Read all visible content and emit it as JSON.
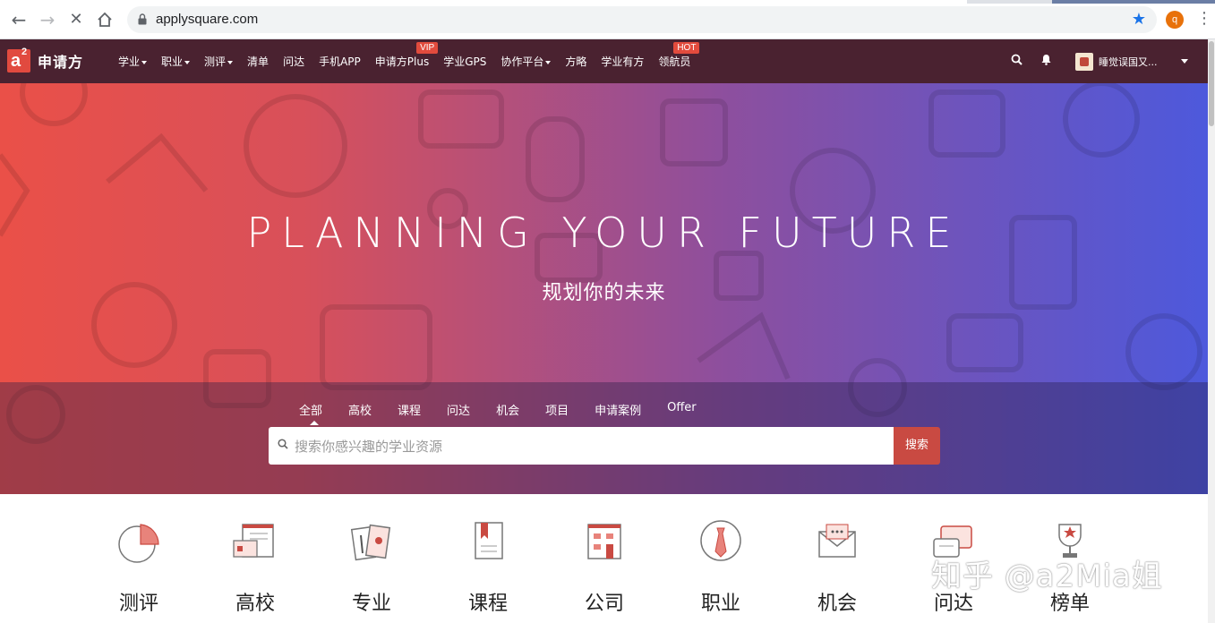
{
  "browser": {
    "url": "applysquare.com",
    "profile_initial": "q"
  },
  "site": {
    "logo_mark": "a",
    "logo_sup": "2",
    "logo_text": "申请方",
    "menu": [
      {
        "label": "学业",
        "dropdown": true,
        "badge": ""
      },
      {
        "label": "职业",
        "dropdown": true,
        "badge": ""
      },
      {
        "label": "测评",
        "dropdown": true,
        "badge": ""
      },
      {
        "label": "清单",
        "dropdown": false,
        "badge": ""
      },
      {
        "label": "问达",
        "dropdown": false,
        "badge": ""
      },
      {
        "label": "手机APP",
        "dropdown": false,
        "badge": ""
      },
      {
        "label": "申请方Plus",
        "dropdown": false,
        "badge": "VIP"
      },
      {
        "label": "学业GPS",
        "dropdown": false,
        "badge": ""
      },
      {
        "label": "协作平台",
        "dropdown": true,
        "badge": ""
      },
      {
        "label": "方略",
        "dropdown": false,
        "badge": ""
      },
      {
        "label": "学业有方",
        "dropdown": false,
        "badge": ""
      },
      {
        "label": "领航员",
        "dropdown": false,
        "badge": "HOT"
      }
    ],
    "user_name": "睡觉误国又..."
  },
  "hero": {
    "title": "PLANNING YOUR FUTURE",
    "subtitle": "规划你的未来",
    "tabs": [
      "全部",
      "高校",
      "课程",
      "问达",
      "机会",
      "项目",
      "申请案例",
      "Offer"
    ],
    "active_tab": 0,
    "search_placeholder": "搜索你感兴趣的学业资源",
    "search_button": "搜索"
  },
  "categories": [
    {
      "label": "测评",
      "icon": "pie-chart-icon"
    },
    {
      "label": "高校",
      "icon": "school-id-icon"
    },
    {
      "label": "专业",
      "icon": "major-cards-icon"
    },
    {
      "label": "课程",
      "icon": "bookmark-doc-icon"
    },
    {
      "label": "公司",
      "icon": "building-icon"
    },
    {
      "label": "职业",
      "icon": "tie-icon"
    },
    {
      "label": "机会",
      "icon": "envelope-icon"
    },
    {
      "label": "问达",
      "icon": "chat-bubbles-icon"
    },
    {
      "label": "榜单",
      "icon": "trophy-icon"
    }
  ],
  "watermark": "知乎 @a2Mia姐",
  "colors": {
    "accent": "#c94a42",
    "nav_bg": "#4a2230",
    "hero_left": "#ea5048",
    "hero_right": "#4d59dc"
  }
}
